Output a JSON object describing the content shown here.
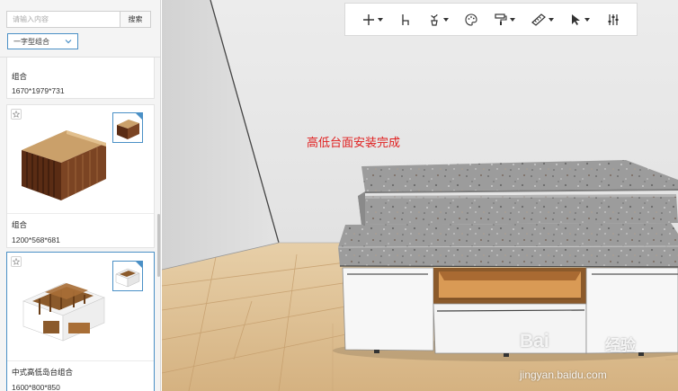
{
  "search": {
    "placeholder": "请输入内容",
    "button_label": "搜索"
  },
  "category_select": {
    "selected": "一字型组合"
  },
  "products": [
    {
      "name": "组合",
      "dims": "1670*1979*731"
    },
    {
      "name": "组合",
      "dims": "1200*568*681"
    },
    {
      "name": "中式高低岛台组合",
      "dims": "1600*800*850",
      "selected": true
    }
  ],
  "toolbar": {
    "tools": [
      {
        "id": "add",
        "icon": "plus-icon",
        "has_dropdown": true
      },
      {
        "id": "chair",
        "icon": "chair-icon",
        "has_dropdown": false
      },
      {
        "id": "decor",
        "icon": "plant-icon",
        "has_dropdown": true
      },
      {
        "id": "palette",
        "icon": "palette-icon",
        "has_dropdown": false
      },
      {
        "id": "paint",
        "icon": "paint-roller-icon",
        "has_dropdown": true
      },
      {
        "id": "measure",
        "icon": "ruler-icon",
        "has_dropdown": true
      },
      {
        "id": "select",
        "icon": "cursor-icon",
        "has_dropdown": true
      },
      {
        "id": "settings",
        "icon": "sliders-icon",
        "has_dropdown": false
      }
    ]
  },
  "scene": {
    "status_message": "高低台面安装完成"
  },
  "watermark": {
    "brand": "Bai",
    "brand_cn": "经验",
    "url": "jingyan.baidu.com"
  },
  "colors": {
    "accent": "#4a90c6",
    "status_red": "#e02020",
    "floor": "#d9b98c",
    "wall": "#e8e8e8",
    "countertop": "#9a9a9a",
    "cabinet": "#ffffff",
    "wood": "#8b5a2b"
  }
}
